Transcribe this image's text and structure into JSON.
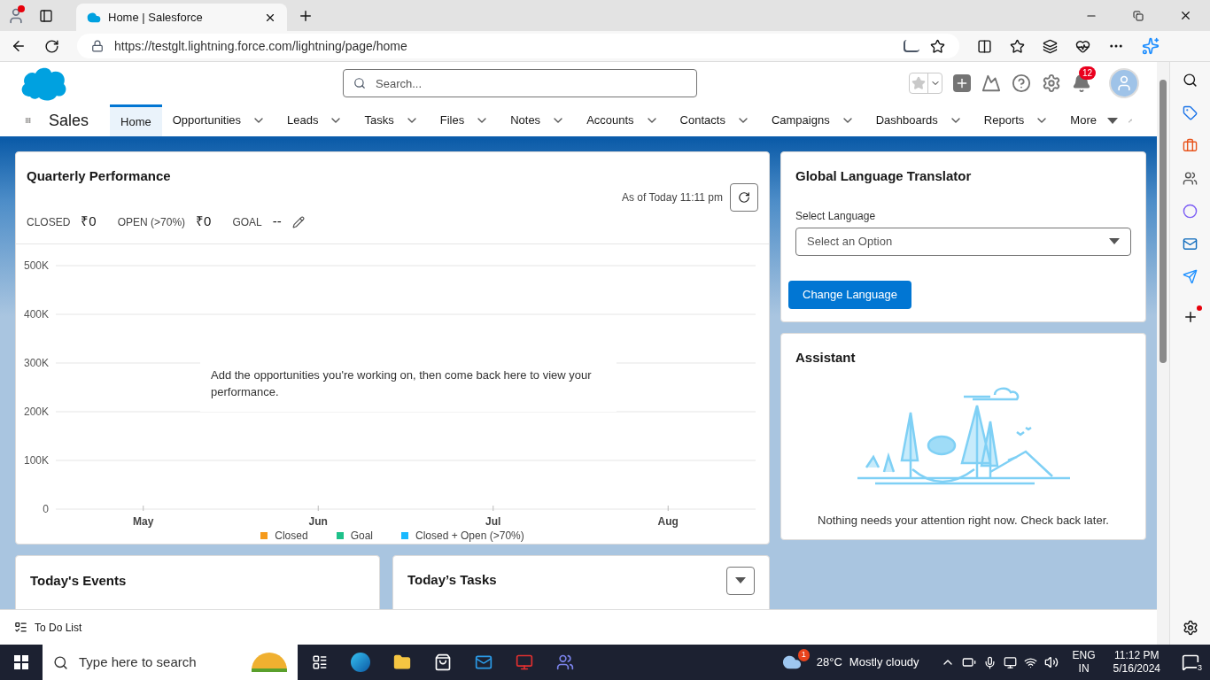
{
  "browser": {
    "tab_title": "Home | Salesforce",
    "url": "https://testglt.lightning.force.com/lightning/page/home"
  },
  "header": {
    "search_placeholder": "Search...",
    "notification_count": "12"
  },
  "nav": {
    "app_name": "Sales",
    "items": [
      {
        "label": "Home",
        "selected": true,
        "kind": "plain"
      },
      {
        "label": "Opportunities",
        "selected": false,
        "kind": "dropdown"
      },
      {
        "label": "Leads",
        "selected": false,
        "kind": "dropdown"
      },
      {
        "label": "Tasks",
        "selected": false,
        "kind": "dropdown"
      },
      {
        "label": "Files",
        "selected": false,
        "kind": "dropdown"
      },
      {
        "label": "Notes",
        "selected": false,
        "kind": "dropdown"
      },
      {
        "label": "Accounts",
        "selected": false,
        "kind": "dropdown"
      },
      {
        "label": "Contacts",
        "selected": false,
        "kind": "dropdown"
      },
      {
        "label": "Campaigns",
        "selected": false,
        "kind": "dropdown"
      },
      {
        "label": "Dashboards",
        "selected": false,
        "kind": "dropdown"
      },
      {
        "label": "Reports",
        "selected": false,
        "kind": "dropdown"
      },
      {
        "label": "More",
        "selected": false,
        "kind": "more"
      }
    ]
  },
  "quarterly_performance": {
    "title": "Quarterly Performance",
    "as_of": "As of Today 11:11 pm",
    "metrics": [
      {
        "label": "CLOSED",
        "value": "₹0"
      },
      {
        "label": "OPEN (>70%)",
        "value": "₹0"
      },
      {
        "label": "GOAL",
        "value": "--"
      }
    ],
    "message": "Add the opportunities you're working on, then come back here to view your performance.",
    "chart_data": {
      "type": "line",
      "grid": true,
      "categories": [
        "May",
        "Jun",
        "Jul",
        "Aug"
      ],
      "series": [
        {
          "name": "Closed",
          "color": "#f59a1b",
          "values": [
            null,
            null,
            null,
            null
          ]
        },
        {
          "name": "Goal",
          "color": "#1ec18a",
          "values": [
            null,
            null,
            null,
            null
          ]
        },
        {
          "name": "Closed + Open (>70%)",
          "color": "#1ab9ff",
          "values": [
            null,
            null,
            null,
            null
          ]
        }
      ],
      "ylim": [
        0,
        500000
      ],
      "yticks": [
        {
          "value": 0,
          "label": "0"
        },
        {
          "value": 100000,
          "label": "100K"
        },
        {
          "value": 200000,
          "label": "200K"
        },
        {
          "value": 300000,
          "label": "300K"
        },
        {
          "value": 400000,
          "label": "400K"
        },
        {
          "value": 500000,
          "label": "500K"
        }
      ]
    }
  },
  "translator": {
    "title": "Global Language Translator",
    "field_label": "Select Language",
    "placeholder": "Select an Option",
    "button": "Change Language"
  },
  "assistant": {
    "title": "Assistant",
    "message": "Nothing needs your attention right now. Check back later."
  },
  "events": {
    "title": "Today's Events"
  },
  "tasks": {
    "title": "Today’s Tasks"
  },
  "utility_bar": {
    "label": "To Do List"
  },
  "taskbar": {
    "search_placeholder": "Type here to search",
    "weather_badge": "1",
    "temperature": "28°C",
    "condition": "Mostly cloudy",
    "language": "ENG",
    "region": "IN",
    "time": "11:12 PM",
    "date": "5/16/2024",
    "notification_count": "3"
  }
}
